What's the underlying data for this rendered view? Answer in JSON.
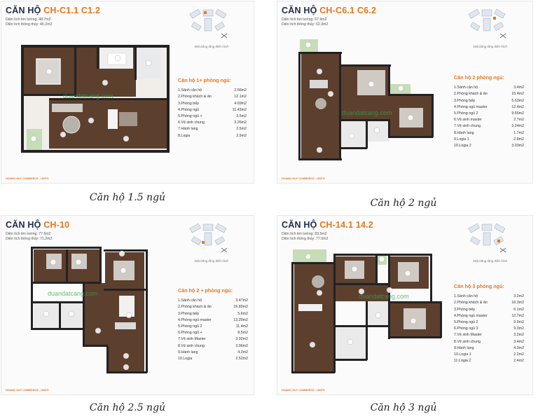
{
  "panels": [
    {
      "title_prefix": "CĂN HỘ",
      "title_code": "CH-C1.1 C1.2",
      "area_wall": "Diện tích tim tường:  48.7m2",
      "area_clear": "Diện tích thông thủy:  45.2m2",
      "site_caption": "Mặt bằng tầng điển hình",
      "watermark": "duandatcang.com",
      "list_title": "Căn hộ 1+ phòng ngủ:",
      "rooms": [
        {
          "name": "1.Sảnh căn hộ",
          "area": "2.66m2"
        },
        {
          "name": "2.Phòng khách & ăn",
          "area": "12.1m2"
        },
        {
          "name": "3.Phòng bếp",
          "area": "4.69m2"
        },
        {
          "name": "4.Phòng ngủ",
          "area": "11.43m2"
        },
        {
          "name": "5.Phòng ngủ +",
          "area": "3.5m2"
        },
        {
          "name": "6.Vệ sinh chung",
          "area": "3.26m2"
        },
        {
          "name": "7.Hành lang",
          "area": "2.5m2"
        },
        {
          "name": "8.Logia",
          "area": "2.9m2"
        }
      ],
      "brand": "HOANG HUY COMMERCE - UNITS",
      "caption": "Căn hộ 1.5 ngủ"
    },
    {
      "title_prefix": "CĂN HỘ",
      "title_code": "CH-C6.1 C6.2",
      "area_wall": "Diện tích tim tường:  67.9m2",
      "area_clear": "Diện tích thông thủy:  62.3m2",
      "site_caption": "Mặt bằng tầng điển hình",
      "watermark": "duandatcang.com",
      "list_title": "Căn hộ 2 phòng ngủ:",
      "rooms": [
        {
          "name": "1.Sảnh căn hộ",
          "area": "3.4m2"
        },
        {
          "name": "2.Phòng khách & ăn",
          "area": "15.4m2"
        },
        {
          "name": "3.Phòng bếp",
          "area": "5.63m2"
        },
        {
          "name": "4.Phòng ngủ master",
          "area": "12.4m2"
        },
        {
          "name": "5.Phòng ngủ 2",
          "area": "9.65m2"
        },
        {
          "name": "6.Vệ sinh master",
          "area": "2.7m2"
        },
        {
          "name": "7.Vệ sinh chung",
          "area": "3.24m2"
        },
        {
          "name": "8.Hành lang",
          "area": "1.7m2"
        },
        {
          "name": "9.Logia 1",
          "area": "2.8m2"
        },
        {
          "name": "10.Logia 2",
          "area": "3.03m2"
        }
      ],
      "brand": "HOANG HUY COMMERCE - UNITS",
      "caption": "Căn hộ 2 ngủ"
    },
    {
      "title_prefix": "CĂN HỘ",
      "title_code": "CH-10",
      "area_wall": "Diện tích tim tường:  77.6m2",
      "area_clear": "Diện tích thông thủy:  71.2m2",
      "site_caption": "Mặt bằng tầng điển hình",
      "watermark": "duandatcang.com",
      "list_title": "Căn hộ 2 + phòng ngủ:",
      "rooms": [
        {
          "name": "1.Sảnh căn hộ",
          "area": "3.47m2"
        },
        {
          "name": "2.Phòng khách & ăn",
          "area": "16.83m2"
        },
        {
          "name": "3.Phòng bếp",
          "area": "5.6m2"
        },
        {
          "name": "4.Phòng ngủ master",
          "area": "13.29m2"
        },
        {
          "name": "5.Phòng ngủ 2",
          "area": "11.4m2"
        },
        {
          "name": "6.Phòng ngủ +",
          "area": "8.5m2"
        },
        {
          "name": "7.Vệ sinh Master",
          "area": "3.92m2"
        },
        {
          "name": "8.Vệ sinh chung",
          "area": "3.96m2"
        },
        {
          "name": "9.Hành lang",
          "area": "4.2m2"
        },
        {
          "name": "10.Logia",
          "area": "2.52m2"
        }
      ],
      "brand": "HOANG HUY COMMERCE - UNITS",
      "caption": "Căn hộ 2.5 ngủ"
    },
    {
      "title_prefix": "CĂN HỘ",
      "title_code": "CH-14.1 14.2",
      "area_wall": "Diện tích tim tường:  83.5m2",
      "area_clear": "Diện tích thông thủy:  77.0m2",
      "site_caption": "Mặt bằng tầng điển hình",
      "watermark": "duandatcang.com",
      "list_title": "Căn hộ 3 phòng ngủ:",
      "rooms": [
        {
          "name": "1.Sảnh căn hộ",
          "area": "3.2m2"
        },
        {
          "name": "2.Phòng khách & ăn",
          "area": "16.3m2"
        },
        {
          "name": "3.Phòng bếp",
          "area": "6.1m2"
        },
        {
          "name": "4.Phòng ngủ master",
          "area": "12.7m2"
        },
        {
          "name": "5.Phòng ngủ 2",
          "area": "9.9m2"
        },
        {
          "name": "6.Phòng ngủ 3",
          "area": "9.3m2"
        },
        {
          "name": "7.Vệ sinh Master",
          "area": "3.3m2"
        },
        {
          "name": "8.Vệ sinh chung",
          "area": "3.4m2"
        },
        {
          "name": "9.Hành lang",
          "area": "4.3m2"
        },
        {
          "name": "10.Logia 1",
          "area": "2.2m2"
        },
        {
          "name": "11.Logia 2",
          "area": "2.4m2"
        }
      ],
      "brand": "HOANG HUY COMMERCE - UNITS",
      "caption": "Căn hộ 3 ngủ"
    }
  ],
  "colors": {
    "accent": "#e8761e",
    "navy": "#1d2a4a",
    "wall": "#222222",
    "floor": "#5a3a2a",
    "watermark": "#2fa84f"
  }
}
